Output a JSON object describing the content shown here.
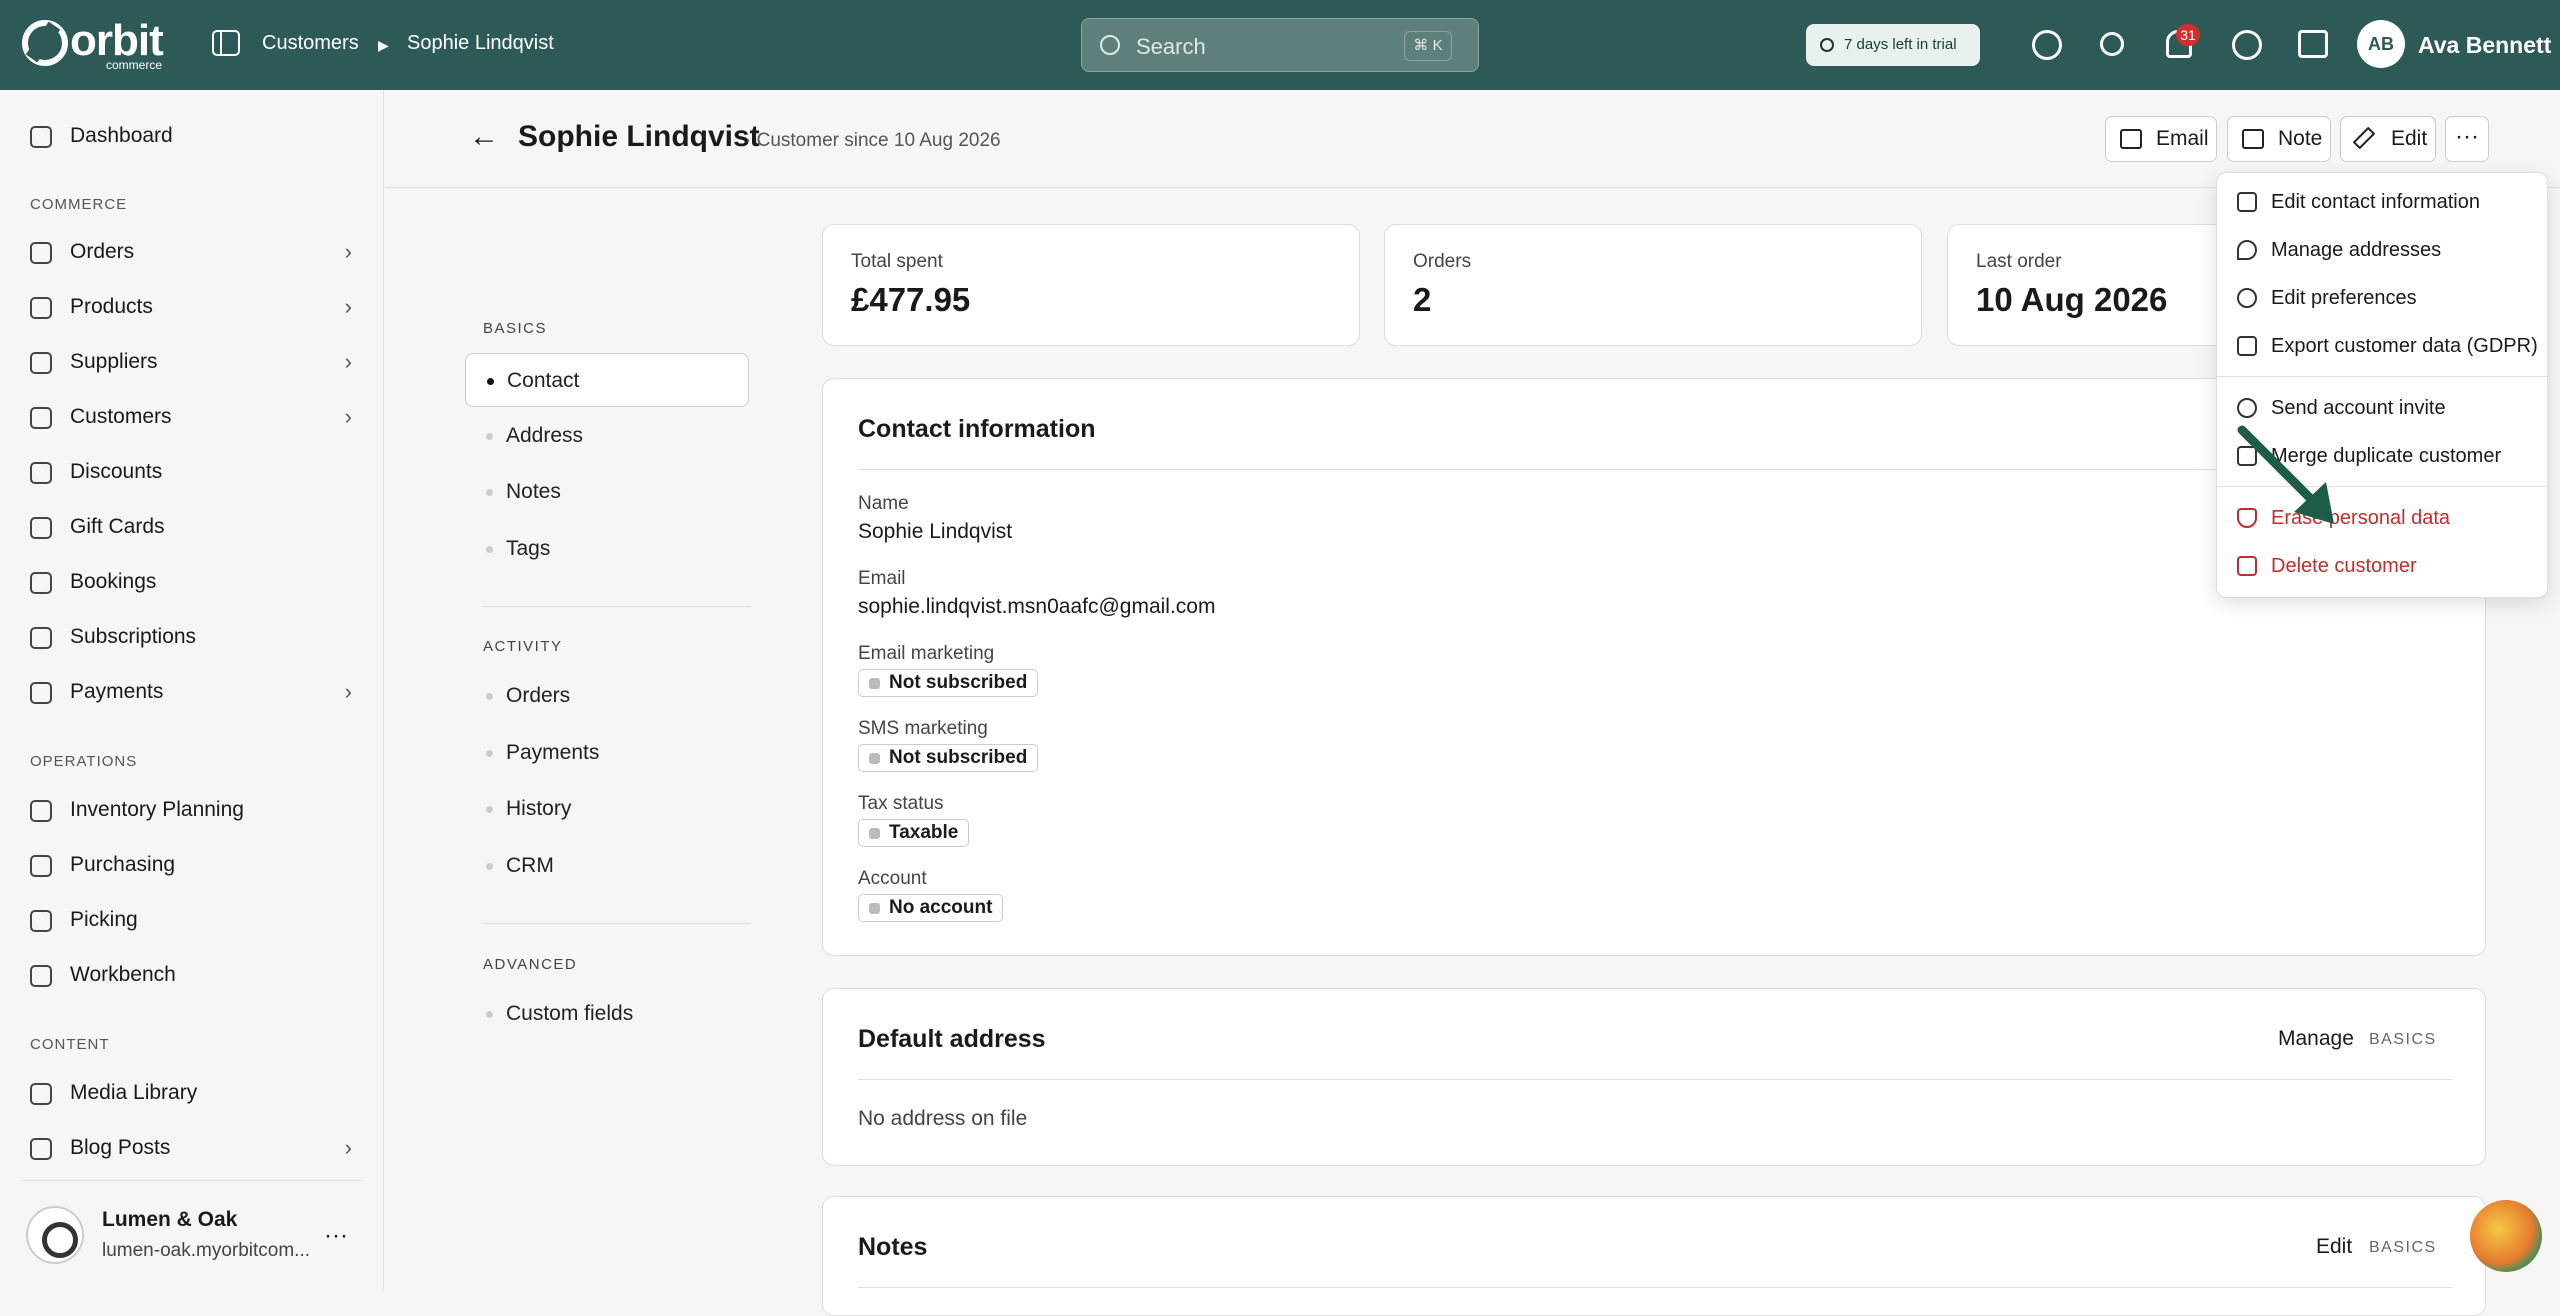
{
  "topbar": {
    "logo_word": "orbit",
    "logo_sub": "commerce",
    "breadcrumb_1": "Customers",
    "breadcrumb_2": "Sophie Lindqvist",
    "search_placeholder": "Search",
    "search_shortcut": "⌘ K",
    "trial": "7 days left in trial",
    "notifications": "31",
    "avatar_initials": "AB",
    "user_name": "Ava Bennett"
  },
  "sidebar": {
    "dashboard": "Dashboard",
    "sec_commerce": "COMMERCE",
    "orders": "Orders",
    "products": "Products",
    "suppliers": "Suppliers",
    "customers": "Customers",
    "discounts": "Discounts",
    "gift_cards": "Gift Cards",
    "bookings": "Bookings",
    "subscriptions": "Subscriptions",
    "payments": "Payments",
    "sec_operations": "OPERATIONS",
    "inventory": "Inventory Planning",
    "purchasing": "Purchasing",
    "picking": "Picking",
    "workbench": "Workbench",
    "sec_content": "CONTENT",
    "media": "Media Library",
    "blog": "Blog Posts",
    "store_name": "Lumen & Oak",
    "store_url": "lumen-oak.myorbitcom..."
  },
  "header": {
    "title": "Sophie Lindqvist",
    "subtitle": "· Customer since 10 Aug 2026",
    "email": "Email",
    "note": "Note",
    "edit": "Edit",
    "more": "···"
  },
  "subnav": {
    "sec_basics": "BASICS",
    "contact": "Contact",
    "address": "Address",
    "notes": "Notes",
    "tags": "Tags",
    "sec_activity": "ACTIVITY",
    "orders": "Orders",
    "payments": "Payments",
    "history": "History",
    "crm": "CRM",
    "sec_advanced": "ADVANCED",
    "custom_fields": "Custom fields"
  },
  "stats": {
    "total_label": "Total spent",
    "total_value": "£477.95",
    "orders_label": "Orders",
    "orders_value": "2",
    "last_label": "Last order",
    "last_value": "10 Aug 2026"
  },
  "contact": {
    "title": "Contact information",
    "name_label": "Name",
    "name": "Sophie Lindqvist",
    "email_label": "Email",
    "email": "sophie.lindqvist.msn0aafc@gmail.com",
    "email_mkt_label": "Email marketing",
    "email_mkt": "Not subscribed",
    "sms_label": "SMS marketing",
    "sms": "Not subscribed",
    "tax_label": "Tax status",
    "tax": "Taxable",
    "account_label": "Account",
    "account": "No account"
  },
  "address": {
    "title": "Default address",
    "manage": "Manage",
    "tag": "BASICS",
    "empty": "No address on file"
  },
  "notes": {
    "title": "Notes",
    "edit": "Edit",
    "tag": "BASICS"
  },
  "menu": {
    "edit_contact": "Edit contact information",
    "manage_addresses": "Manage addresses",
    "edit_prefs": "Edit preferences",
    "export": "Export customer data (GDPR)",
    "invite": "Send account invite",
    "merge": "Merge duplicate customer",
    "erase": "Erase personal data",
    "delete": "Delete customer"
  }
}
